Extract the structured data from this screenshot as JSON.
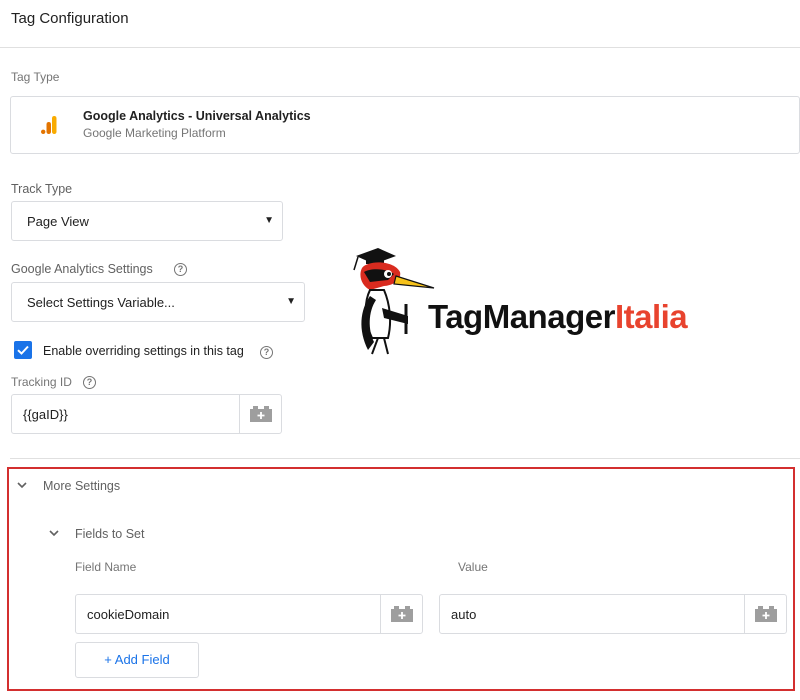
{
  "header": {
    "title": "Tag Configuration"
  },
  "tag_type": {
    "label": "Tag Type",
    "name": "Google Analytics - Universal Analytics",
    "provider": "Google Marketing Platform",
    "icon": "google-analytics-icon",
    "icon_colors": [
      "#f9ab00",
      "#e37400"
    ]
  },
  "track_type": {
    "label": "Track Type",
    "selected": "Page View"
  },
  "ga_settings": {
    "label": "Google Analytics Settings",
    "selected": "Select Settings Variable..."
  },
  "override": {
    "label": "Enable overriding settings in this tag",
    "checked": true
  },
  "tracking_id": {
    "label": "Tracking ID",
    "value": "{{gaID}}"
  },
  "more_settings": {
    "title": "More Settings",
    "fields_to_set": {
      "title": "Fields to Set",
      "field_name_header": "Field Name",
      "value_header": "Value",
      "rows": [
        {
          "field_name": "cookieDomain",
          "value": "auto"
        }
      ],
      "add_label": "+ Add Field"
    }
  },
  "logo": {
    "part1": "TagManager",
    "part2": "Italia"
  },
  "colors": {
    "accent": "#1a73e8",
    "highlight_border": "#d32f2f",
    "logo_red": "#e8432e"
  }
}
